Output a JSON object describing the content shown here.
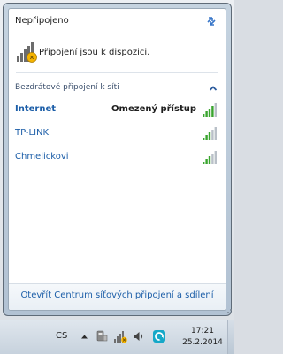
{
  "flyout": {
    "status_title": "Nepřipojeno",
    "message": "Připojení jsou k dispozici.",
    "section_label": "Bezdrátové připojení k síti",
    "networks": [
      {
        "name": "Internet",
        "status": "Omezený přístup",
        "signal": 4,
        "bold": true
      },
      {
        "name": "TP-LINK",
        "status": "",
        "signal": 3,
        "bold": false
      },
      {
        "name": "Chmelickovi",
        "status": "",
        "signal": 3,
        "bold": false
      }
    ],
    "footer_link": "Otevřít Centrum síťových připojení a sdílení"
  },
  "taskbar": {
    "language": "CS",
    "time": "17:21",
    "date": "25.2.2014"
  },
  "colors": {
    "link": "#1c5ea8",
    "signal_active": "#3aa52f",
    "signal_inactive": "#b9c0c8"
  }
}
